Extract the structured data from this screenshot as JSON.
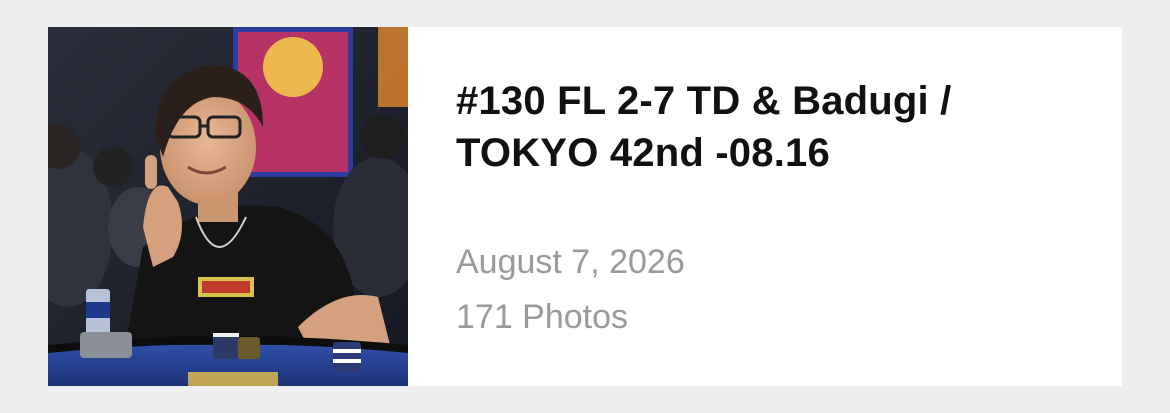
{
  "album": {
    "title_line1": "#130 FL 2-7 TD & Badugi /",
    "title_line2": "TOKYO 42nd -08.16",
    "date": "August 7, 2026",
    "photo_count": "171 Photos",
    "thumbnail": "player-photo"
  },
  "colors": {
    "background": "#efefef",
    "card": "#ffffff",
    "title": "#111111",
    "meta": "#9a9a9a"
  }
}
